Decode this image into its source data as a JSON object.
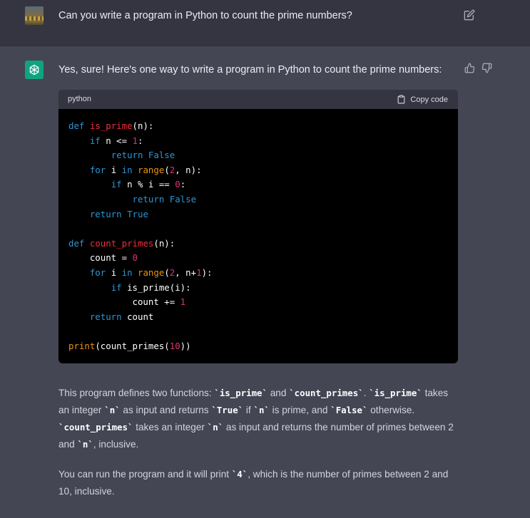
{
  "user_message": {
    "text": "Can you write a program in Python to count the prime numbers?"
  },
  "assistant_message": {
    "intro": "Yes, sure! Here's one way to write a program in Python to count the prime numbers:",
    "code_block": {
      "language": "python",
      "copy_label": "Copy code",
      "lines": [
        "def is_prime(n):",
        "    if n <= 1:",
        "        return False",
        "    for i in range(2, n):",
        "        if n % i == 0:",
        "            return False",
        "    return True",
        "",
        "def count_primes(n):",
        "    count = 0",
        "    for i in range(2, n+1):",
        "        if is_prime(i):",
        "            count += 1",
        "    return count",
        "",
        "print(count_primes(10))"
      ]
    },
    "paragraph1": {
      "t1": "This program defines two functions: ",
      "c1": "`is_prime`",
      "t2": " and ",
      "c2": "`count_primes`",
      "t3": ". ",
      "c3": "`is_prime`",
      "t4": " takes an integer ",
      "c4": "`n`",
      "t5": " as input and returns ",
      "c5": "`True`",
      "t6": " if ",
      "c6": "`n`",
      "t7": " is prime, and ",
      "c7": "`False`",
      "t8": " otherwise. ",
      "c8": "`count_primes`",
      "t9": " takes an integer ",
      "c9": "`n`",
      "t10": " as input and returns the number of primes between 2 and ",
      "c10": "`n`",
      "t11": ", inclusive."
    },
    "paragraph2": {
      "t1": "You can run the program and it will print ",
      "c1": "`4`",
      "t2": ", which is the number of primes between 2 and 10, inclusive."
    }
  },
  "icons": {
    "user_avatar": "user-photo-avatar",
    "bot_avatar": "openai-logo-icon",
    "edit": "edit-icon",
    "thumb_up": "thumbs-up-icon",
    "thumb_down": "thumbs-down-icon",
    "copy": "clipboard-icon"
  },
  "colors": {
    "bot_avatar_bg": "#10a37f",
    "user_row_bg": "#343541",
    "assistant_row_bg": "#444654"
  }
}
